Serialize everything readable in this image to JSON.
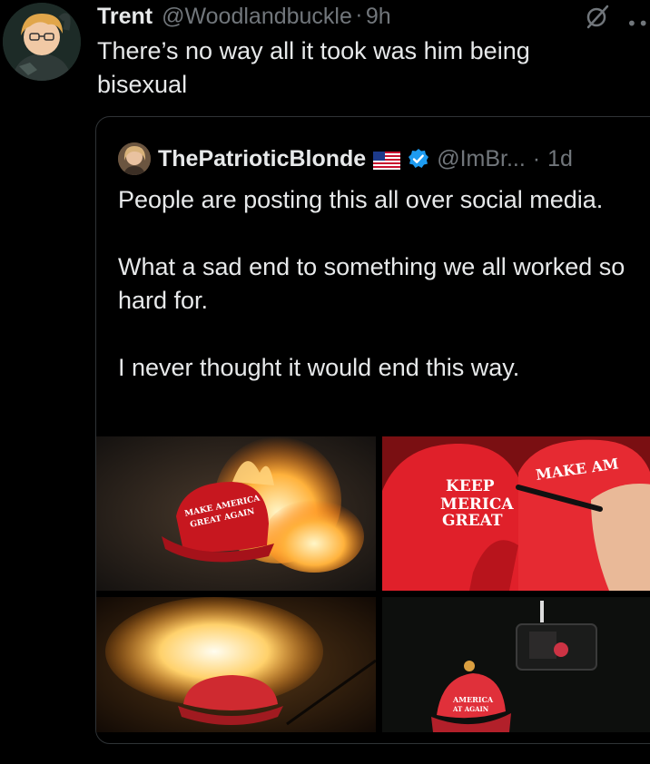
{
  "post": {
    "author_name": "Trent",
    "author_handle": "@Woodlandbuckle",
    "separator": "·",
    "time": "9h",
    "text": "There’s no way all it took was him being bisexual",
    "more_icon": "more-icon",
    "grok_icon": "grok-icon"
  },
  "quote": {
    "author_name": "ThePatrioticBlonde",
    "flag_icon": "us-flag-icon",
    "verified_icon": "verified-badge-icon",
    "handle": "@ImBr...",
    "separator": "·",
    "time": "1d",
    "paragraphs": [
      "People are posting this all over social media.",
      "What a sad end to something we all worked so hard for.",
      "I never thought it would end this way."
    ],
    "media": [
      {
        "caption_line1": "MAKE AMERICA",
        "caption_line2": "GREAT AGAIN"
      },
      {
        "caption_line1": "KEEP",
        "caption_line2": "MERICA",
        "caption_line3": "GREAT",
        "caption_line4": "MAKE AM"
      },
      {},
      {
        "caption_line1": "AMERICA",
        "caption_line2": "AT AGAIN"
      }
    ]
  },
  "colors": {
    "background": "#000000",
    "text_primary": "#e7e9ea",
    "text_secondary": "#71767b",
    "border": "#2f3336",
    "verified_blue": "#1d9bf0",
    "hat_red": "#d8232a"
  }
}
